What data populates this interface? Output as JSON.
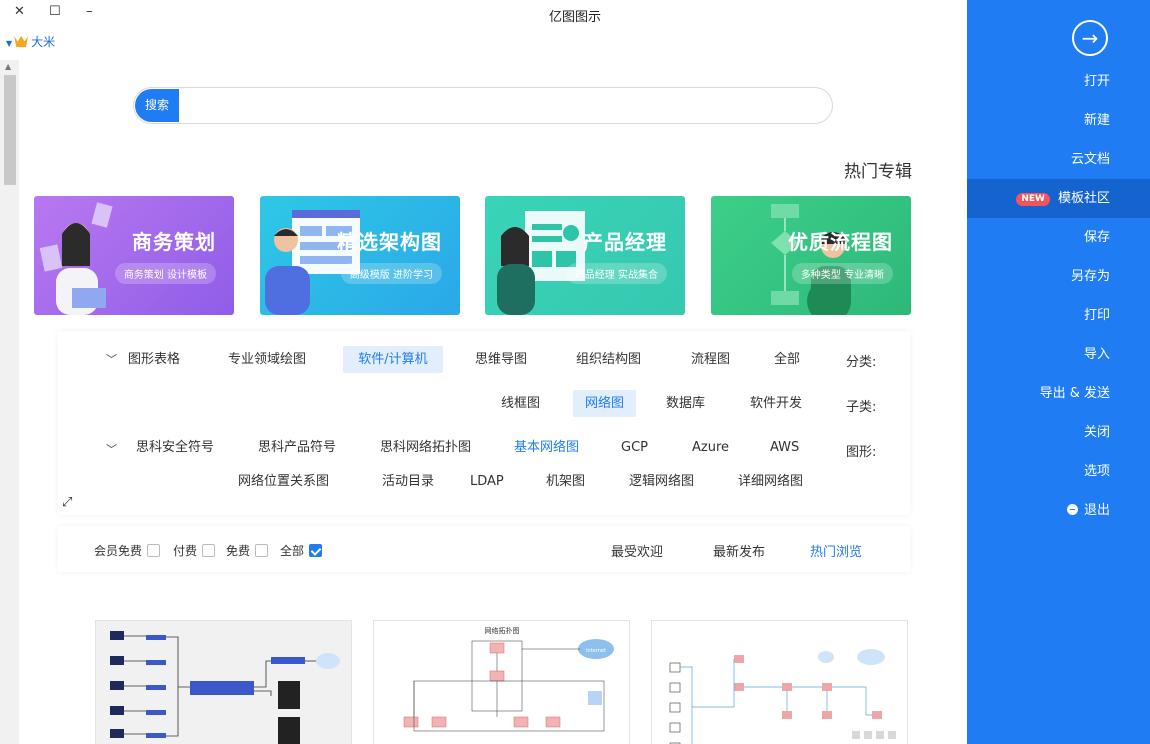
{
  "window": {
    "title": "亿图图示",
    "user": "大米",
    "controls": {
      "close": "✕",
      "maximize": "☐",
      "minimize": "–"
    }
  },
  "sidebar": {
    "back_icon": "arrow-right-circle-icon",
    "items": [
      {
        "label": "打开"
      },
      {
        "label": "新建"
      },
      {
        "label": "云文档"
      },
      {
        "label": "模板社区",
        "badge": "NEW",
        "active": true
      },
      {
        "label": "保存"
      },
      {
        "label": "另存为"
      },
      {
        "label": "打印"
      },
      {
        "label": "导入"
      },
      {
        "label": "导出 & 发送"
      },
      {
        "label": "关闭"
      },
      {
        "label": "选项"
      },
      {
        "label": "退出"
      }
    ]
  },
  "search": {
    "button": "搜索",
    "placeholder": ""
  },
  "section_title": "热门专辑",
  "banners": [
    {
      "title": "优质流程图",
      "subtitle": "多种类型 专业清晰"
    },
    {
      "title": "产品经理",
      "subtitle": "产品经理 实战集合"
    },
    {
      "title": "精选架构图",
      "subtitle": "高级模版 进阶学习"
    },
    {
      "title": "商务策划",
      "subtitle": "商务策划 设计模板"
    }
  ],
  "filters": {
    "category_label": "分类:",
    "categories": [
      "全部",
      "流程图",
      "组织结构图",
      "思维导图",
      "软件/计算机",
      "专业领域绘图",
      "图形表格"
    ],
    "category_selected": "软件/计算机",
    "subcategory_label": "子类:",
    "subcategories": [
      "软件开发",
      "数据库",
      "网络图",
      "线框图"
    ],
    "subcategory_selected": "网络图",
    "shape_label": "图形:",
    "shapes_row1": [
      "AWS",
      "Azure",
      "GCP",
      "基本网络图",
      "思科网络拓扑图",
      "思科产品符号",
      "思科安全符号"
    ],
    "shapes_row2": [
      "详细网络图",
      "逻辑网络图",
      "机架图",
      "LDAP",
      "活动目录",
      "网络位置关系图"
    ],
    "shape_highlight": "基本网络图"
  },
  "sortbar": {
    "sorts": [
      "热门浏览",
      "最新发布",
      "最受欢迎"
    ],
    "sort_active": "热门浏览",
    "checks": [
      {
        "label": "全部",
        "checked": true
      },
      {
        "label": "免费",
        "checked": false
      },
      {
        "label": "付费",
        "checked": false
      },
      {
        "label": "会员免费",
        "checked": false
      }
    ]
  },
  "cards": [
    {
      "title": "",
      "label_in_image": "网络拓扑图",
      "cloud_label": "Internet"
    },
    {
      "title": ""
    },
    {
      "title": ""
    }
  ],
  "colors": {
    "accent": "#1f7cf2",
    "sidebar_active": "#1463cf",
    "badge": "#f2545b"
  }
}
